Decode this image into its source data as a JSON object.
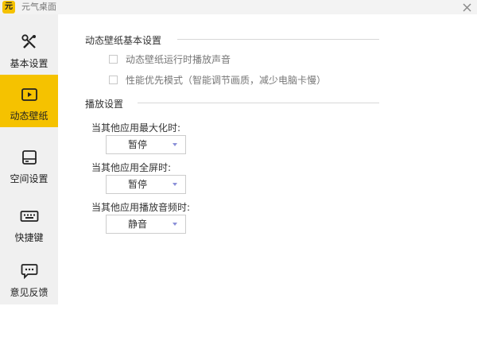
{
  "window": {
    "title": "元气桌面",
    "logo_text": "元",
    "close_icon": "close-icon"
  },
  "sidebar": {
    "items": [
      {
        "label": "基本设置",
        "icon": "tools-icon",
        "active": false
      },
      {
        "label": "动态壁纸",
        "icon": "play-icon",
        "active": true
      },
      {
        "label": "空间设置",
        "icon": "drive-icon",
        "active": false
      },
      {
        "label": "快捷键",
        "icon": "keyboard-icon",
        "active": false
      },
      {
        "label": "意见反馈",
        "icon": "feedback-icon",
        "active": false
      }
    ]
  },
  "basic_section": {
    "title": "动态壁纸基本设置",
    "options": [
      {
        "label": "动态壁纸运行时播放声音",
        "checked": false
      },
      {
        "label": "性能优先模式（智能调节画质，减少电脑卡慢）",
        "checked": false
      }
    ]
  },
  "playback_section": {
    "title": "播放设置",
    "settings": [
      {
        "label": "当其他应用最大化时:",
        "value": "暂停"
      },
      {
        "label": "当其他应用全屏时:",
        "value": "暂停"
      },
      {
        "label": "当其他应用播放音频时:",
        "value": "静音"
      }
    ]
  },
  "colors": {
    "accent": "#f5c200",
    "sidebar_bg": "#f0f0f0",
    "dropdown_arrow": "#8a8fd8"
  }
}
